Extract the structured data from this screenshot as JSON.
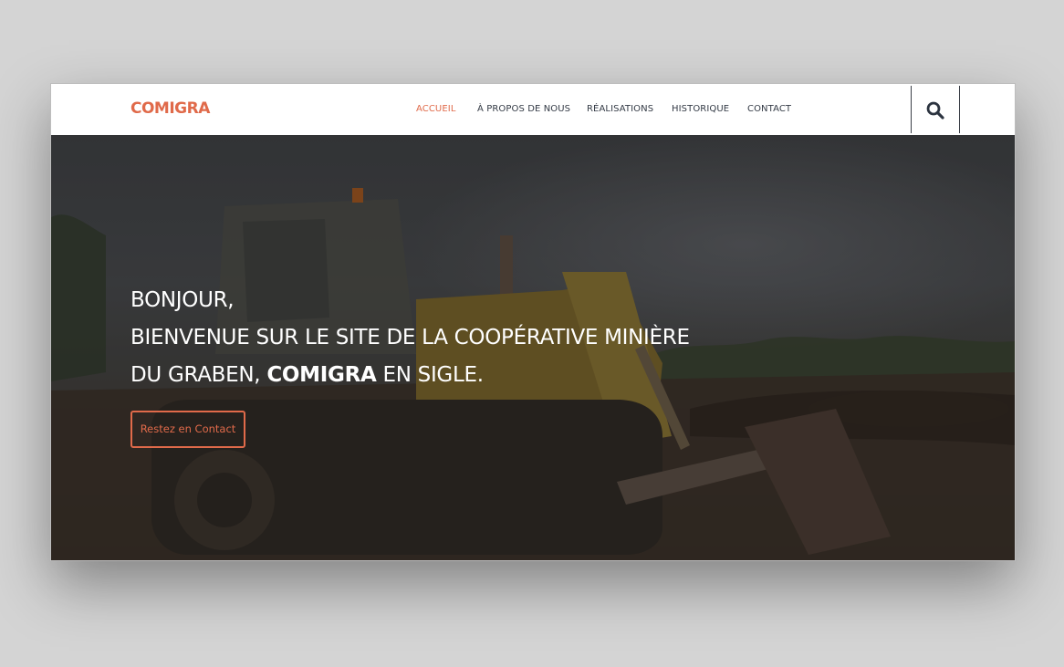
{
  "colors": {
    "accent": "#e06a4a",
    "nav_text": "#333a45",
    "hero_text": "#ffffff"
  },
  "header": {
    "logo": "COMIGRA",
    "nav": [
      {
        "label": "ACCUEIL",
        "active": true
      },
      {
        "label": "À PROPOS DE NOUS",
        "active": false
      },
      {
        "label": "RÉALISATIONS",
        "active": false
      },
      {
        "label": "HISTORIQUE",
        "active": false
      },
      {
        "label": "CONTACT",
        "active": false
      }
    ],
    "search_icon": "search-icon"
  },
  "hero": {
    "line1": "BONJOUR,",
    "line2": "BIENVENUE SUR LE SITE DE LA COOPÉRATIVE MINIÈRE",
    "line3_prefix": "DU GRABEN, ",
    "line3_strong": "COMIGRA",
    "line3_suffix": " EN SIGLE.",
    "cta_label": "Restez en Contact",
    "background_image": "bulldozer-photo"
  }
}
